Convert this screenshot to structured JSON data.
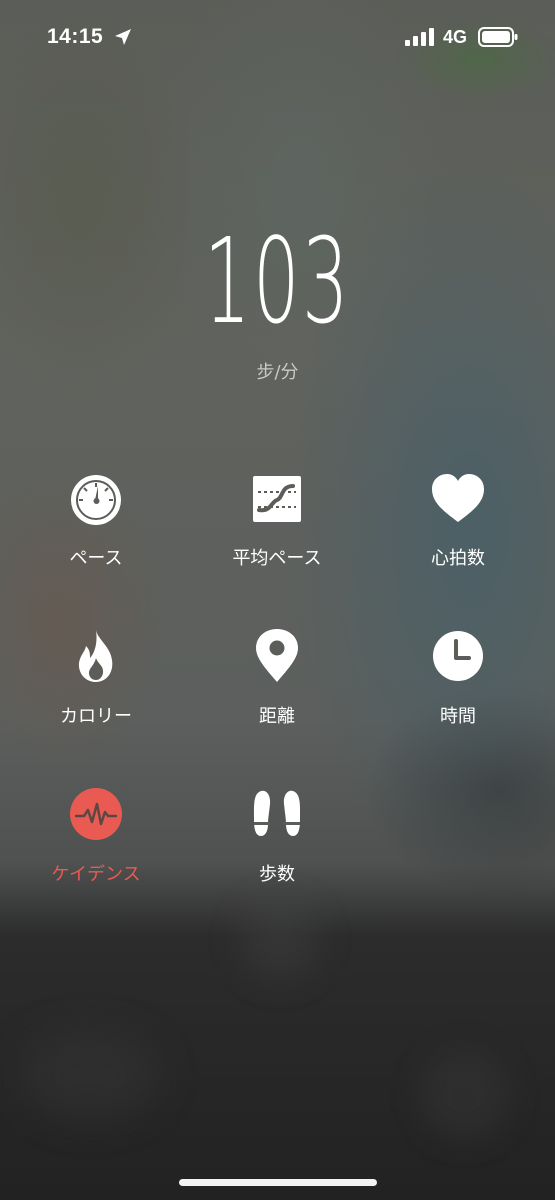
{
  "status_bar": {
    "time": "14:15",
    "network": "4G"
  },
  "metric": {
    "value": "103",
    "unit": "步/分"
  },
  "metric_options": [
    {
      "label": "ペース",
      "icon": "speedometer-icon"
    },
    {
      "label": "平均ペース",
      "icon": "average-pace-icon"
    },
    {
      "label": "心拍数",
      "icon": "heart-icon"
    },
    {
      "label": "カロリー",
      "icon": "flame-icon"
    },
    {
      "label": "距離",
      "icon": "location-pin-icon"
    },
    {
      "label": "時間",
      "icon": "clock-icon"
    },
    {
      "label": "ケイデンス",
      "icon": "cadence-pulse-icon"
    },
    {
      "label": "歩数",
      "icon": "footprints-icon"
    }
  ],
  "colors": {
    "accent": "#e95a52",
    "text": "#ffffff",
    "unit_text": "#c9c9c9"
  }
}
